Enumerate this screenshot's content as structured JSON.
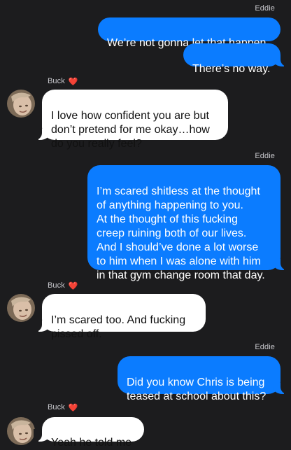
{
  "messages": [
    {
      "sender": "Eddie",
      "text": "We’re not gonna let that happen."
    },
    {
      "text": "There’s no way."
    },
    {
      "sender": "Buck",
      "heart": "❤️",
      "text": "I love how confident you are but\ndon’t pretend for me okay…how\ndo you really feel?"
    },
    {
      "sender": "Eddie",
      "text": "I’m scared shitless at the thought\nof anything happening to you.\nAt the thought of this fucking\ncreep ruining both of our lives.\nAnd I should’ve done a lot worse\nto him when I was alone with him\nin that gym change room that day."
    },
    {
      "sender": "Buck",
      "heart": "❤️",
      "text": "I’m scared too. And fucking\npissed off."
    },
    {
      "sender": "Eddie",
      "text": "Did you know Chris is being\nteased at school about this?"
    },
    {
      "sender": "Buck",
      "heart": "❤️",
      "text": "Yeah he told me"
    }
  ],
  "colors": {
    "background": "#1c1c1e",
    "outgoing_bubble": "#0b7cff",
    "incoming_bubble": "#ffffff",
    "sender_label": "#c7c7cc"
  },
  "icons": {
    "avatar": "contact-avatar-photo",
    "heart": "red-heart-emoji"
  }
}
